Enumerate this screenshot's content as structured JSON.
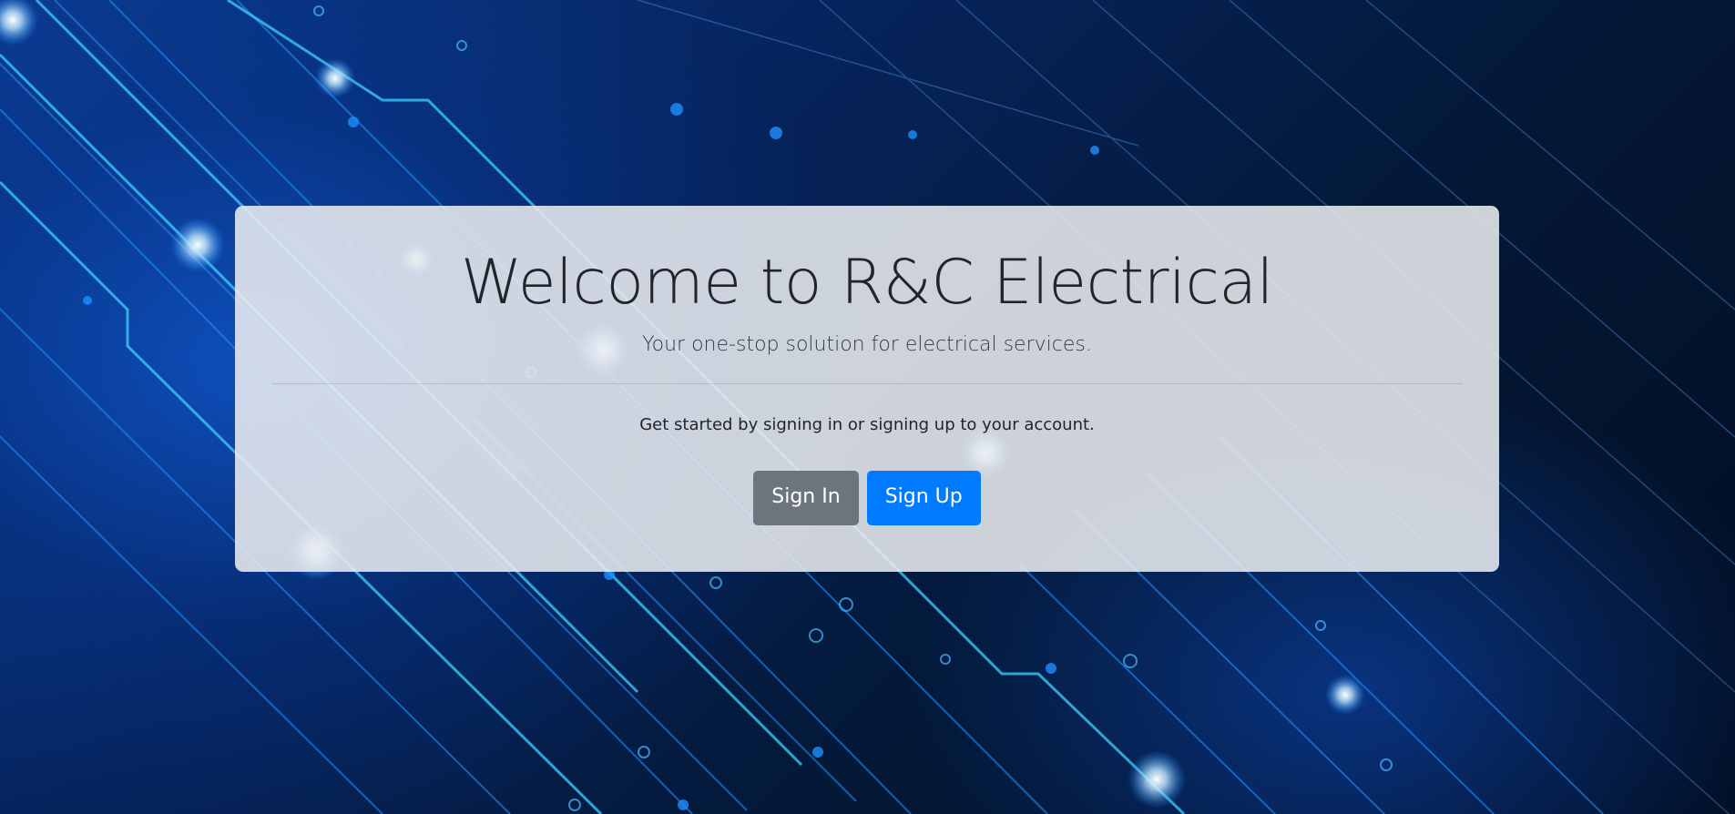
{
  "background": {
    "description_icon": "circuit-board-background",
    "primary_color": "#04132e",
    "accent_color": "#1e8fff"
  },
  "hero": {
    "title": "Welcome to R&C Electrical",
    "lead": "Your one-stop solution for electrical services.",
    "text": "Get started by signing in or signing up to your account.",
    "sign_in_label": "Sign In",
    "sign_up_label": "Sign Up"
  },
  "colors": {
    "sign_in_bg": "#6c757d",
    "sign_up_bg": "#007bff",
    "card_bg": "#e9ecef"
  }
}
